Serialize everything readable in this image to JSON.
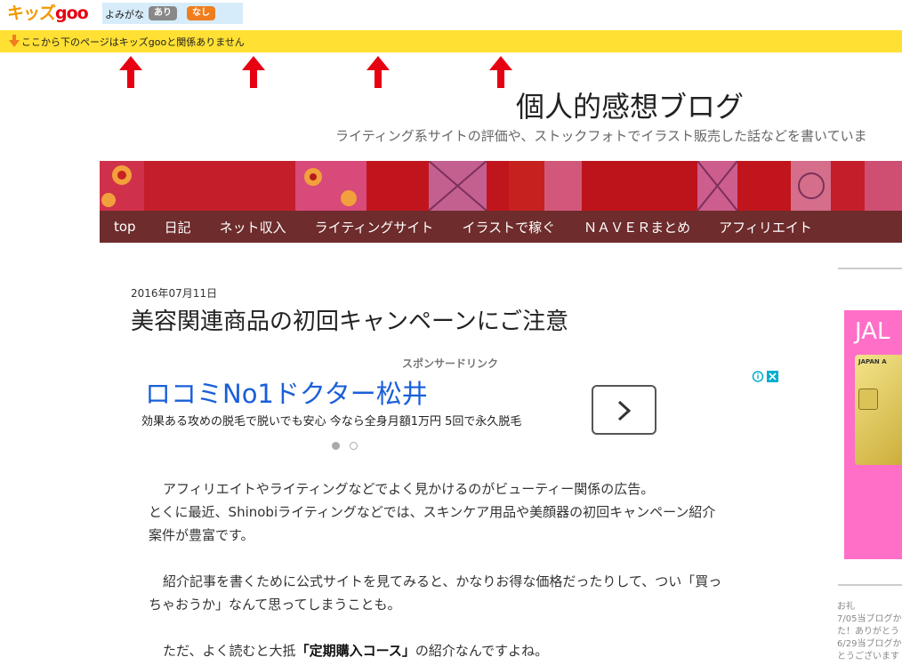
{
  "kidsgoo": {
    "logo_part1": "キッズ",
    "logo_part2": "goo",
    "yomigana_label": "よみがな",
    "yomigana_on": "あり",
    "yomigana_off": "なし",
    "notice_text": "ここから下のページはキッズgooと関係ありません"
  },
  "blog": {
    "title": "個人的感想ブログ",
    "description": "ライティング系サイトの評価や、ストックフォトでイラスト販売した話などを書いていま",
    "nav": [
      "top",
      "日記",
      "ネット収入",
      "ライティングサイト",
      "イラストで稼ぐ",
      "ＮＡＶＥＲまとめ",
      "アフィリエイト"
    ]
  },
  "post": {
    "date": "2016年07月11日",
    "title": "美容関連商品の初回キャンペーンにご注意",
    "para1_line1": "アフィリエイトやライティングなどでよく見かけるのがビューティー関係の広告。",
    "para1_line2": "とくに最近、Shinobiライティングなどでは、スキンケア用品や美顔器の初回キャンペーン紹介",
    "para1_line3": "案件が豊富です。",
    "para2_line1": "紹介記事を書くために公式サイトを見てみると、かなりお得な価格だったりして、つい「買っ",
    "para2_line2": "ちゃおうか」なんて思ってしまうことも。",
    "para3_pre": "ただ、よく読むと大抵",
    "para3_bold": "「定期購入コース」",
    "para3_post": "の紹介なんですよね。"
  },
  "ad": {
    "sponsor_label": "スポンサードリンク",
    "title": "ロコミNo1ドクター松井",
    "description": "効果ある攻めの脱毛で脱いでも安心 今なら全身月額1万円 5回で永久脱毛"
  },
  "sidebar": {
    "ad_title": "JAL",
    "card_text": "JAPAN A",
    "news_heading": "お礼",
    "news_line1": "7/05当ブログか",
    "news_line2": "た！ありがとう",
    "news_line3": "6/29当ブログか",
    "news_line4": "とうございます"
  },
  "colors": {
    "notice_bg": "#ffe033",
    "nav_bg": "#6e2c2c",
    "arrow_red": "#e60012",
    "ad_link": "#1a5fd8",
    "side_ad_bg": "#ff6ec7"
  }
}
